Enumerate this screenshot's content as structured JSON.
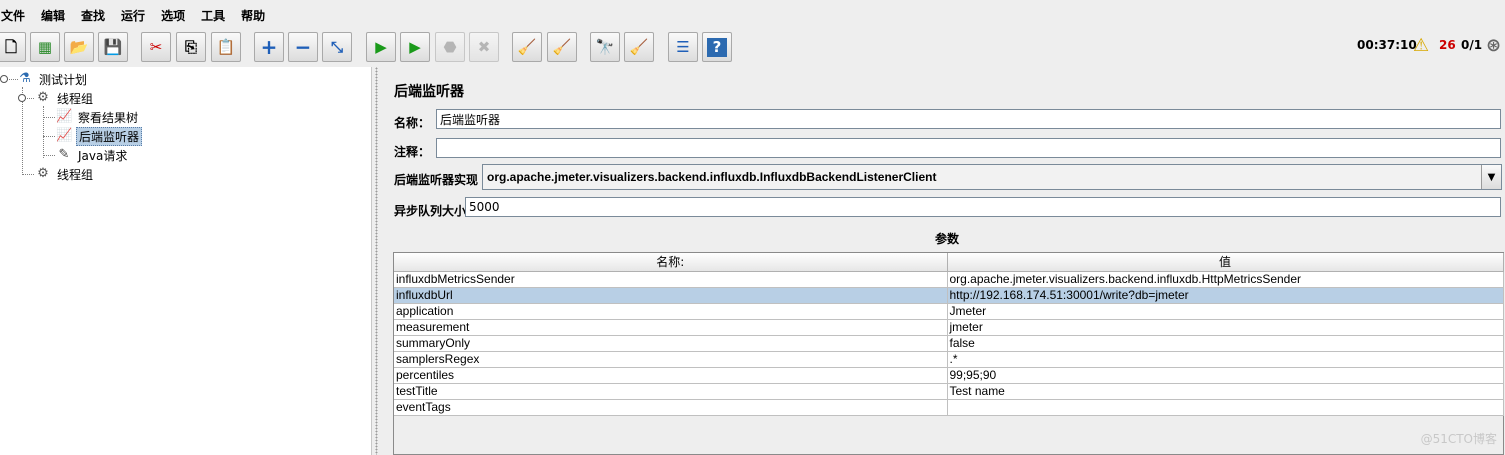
{
  "menu": [
    "文件",
    "编辑",
    "查找",
    "运行",
    "选项",
    "工具",
    "帮助"
  ],
  "toolbar": {
    "buttons": [
      {
        "name": "new-icon",
        "glyph": "🗋"
      },
      {
        "name": "templates-icon",
        "glyph": "▦"
      },
      {
        "name": "open-icon",
        "glyph": "📂"
      },
      {
        "name": "save-icon",
        "glyph": "💾"
      },
      {
        "name": "cut-icon",
        "glyph": "✂"
      },
      {
        "name": "copy-icon",
        "glyph": "⎘"
      },
      {
        "name": "paste-icon",
        "glyph": "📋"
      },
      {
        "name": "expand-icon",
        "glyph": "+"
      },
      {
        "name": "collapse-icon",
        "glyph": "−"
      },
      {
        "name": "toggle-icon",
        "glyph": "⤡"
      },
      {
        "name": "start-icon",
        "glyph": "▶"
      },
      {
        "name": "start-no-pause-icon",
        "glyph": "▶"
      },
      {
        "name": "stop-icon",
        "glyph": "⬣"
      },
      {
        "name": "shutdown-icon",
        "glyph": "✖"
      },
      {
        "name": "clear-icon",
        "glyph": "🧹"
      },
      {
        "name": "clear-all-icon",
        "glyph": "🧹"
      },
      {
        "name": "search-icon",
        "glyph": "🔭"
      },
      {
        "name": "reset-search-icon",
        "glyph": "🧹"
      },
      {
        "name": "function-helper-icon",
        "glyph": "☰"
      },
      {
        "name": "help-icon",
        "glyph": "?"
      }
    ],
    "elapsed_time": "00:37:10",
    "warning_count": "26",
    "threads": "0/1"
  },
  "tree": {
    "test_plan": "测试计划",
    "thread_group_1": "线程组",
    "view_results_tree": "察看结果树",
    "backend_listener": "后端监听器",
    "java_request": "Java请求",
    "thread_group_2": "线程组"
  },
  "panel": {
    "title": "后端监听器",
    "name_label": "名称：",
    "name_value": "后端监听器",
    "comment_label": "注释：",
    "comment_value": "",
    "impl_label": "后端监听器实现",
    "impl_value": "org.apache.jmeter.visualizers.backend.influxdb.InfluxdbBackendListenerClient",
    "queue_label": "异步队列大小",
    "queue_value": "5000",
    "params_title": "参数"
  },
  "table": {
    "headers": [
      "名称:",
      "值"
    ],
    "rows": [
      [
        "influxdbMetricsSender",
        "org.apache.jmeter.visualizers.backend.influxdb.HttpMetricsSender"
      ],
      [
        "influxdbUrl",
        "http://192.168.174.51:30001/write?db=jmeter"
      ],
      [
        "application",
        "Jmeter"
      ],
      [
        "measurement",
        "jmeter"
      ],
      [
        "summaryOnly",
        "false"
      ],
      [
        "samplersRegex",
        ".*"
      ],
      [
        "percentiles",
        "99;95;90"
      ],
      [
        "testTitle",
        "Test name"
      ],
      [
        "eventTags",
        ""
      ]
    ],
    "selected_row": 1
  },
  "watermark": "@51CTO博客",
  "colors": {
    "selection": "#b8cfe5",
    "warning_count": "#cc0000",
    "run_green": "#1a9a1a"
  }
}
